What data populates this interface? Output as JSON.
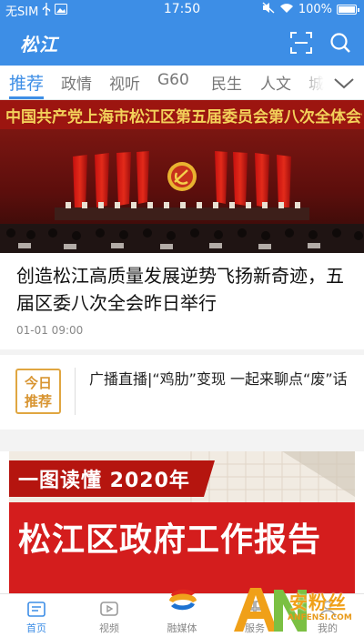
{
  "status_bar": {
    "carrier": "无SIM",
    "time": "17:50",
    "battery": "100%"
  },
  "header": {
    "logo": "松江",
    "scan_icon": "scan-icon",
    "search_icon": "search-icon"
  },
  "tabs": [
    {
      "label": "推荐",
      "active": true
    },
    {
      "label": "政情"
    },
    {
      "label": "视听"
    },
    {
      "label": "G60"
    },
    {
      "label": "民生"
    },
    {
      "label": "人文"
    },
    {
      "label": "城"
    }
  ],
  "hero": {
    "banner_text": "中国共产党上海市松江区第五届委员会第八次全体会议"
  },
  "headline": {
    "title": "创造松江高质量发展逆势飞扬新奇迹，五届区委八次全会昨日举行",
    "time": "01-01 09:00"
  },
  "today": {
    "badge_line1": "今日",
    "badge_line2": "推荐",
    "text": "广播直播|“鸡肋”变现  一起来聊点“废”话"
  },
  "banner": {
    "line1": "一图读懂 2020年",
    "line2": "松江区政府工作报告"
  },
  "bottom_nav": [
    {
      "label": "首页",
      "icon": "home-icon",
      "active": true
    },
    {
      "label": "视频",
      "icon": "video-icon"
    },
    {
      "label": "融媒体",
      "icon": "media-logo-icon"
    },
    {
      "label": "服务",
      "icon": "service-icon"
    },
    {
      "label": "我的",
      "icon": "profile-icon"
    }
  ],
  "watermark": {
    "text": "安粉丝",
    "sub": "ANFENSI.COM"
  },
  "colors": {
    "brand_blue": "#3d8ee6",
    "badge_gold": "#d89532",
    "banner_red": "#d41d1d"
  }
}
